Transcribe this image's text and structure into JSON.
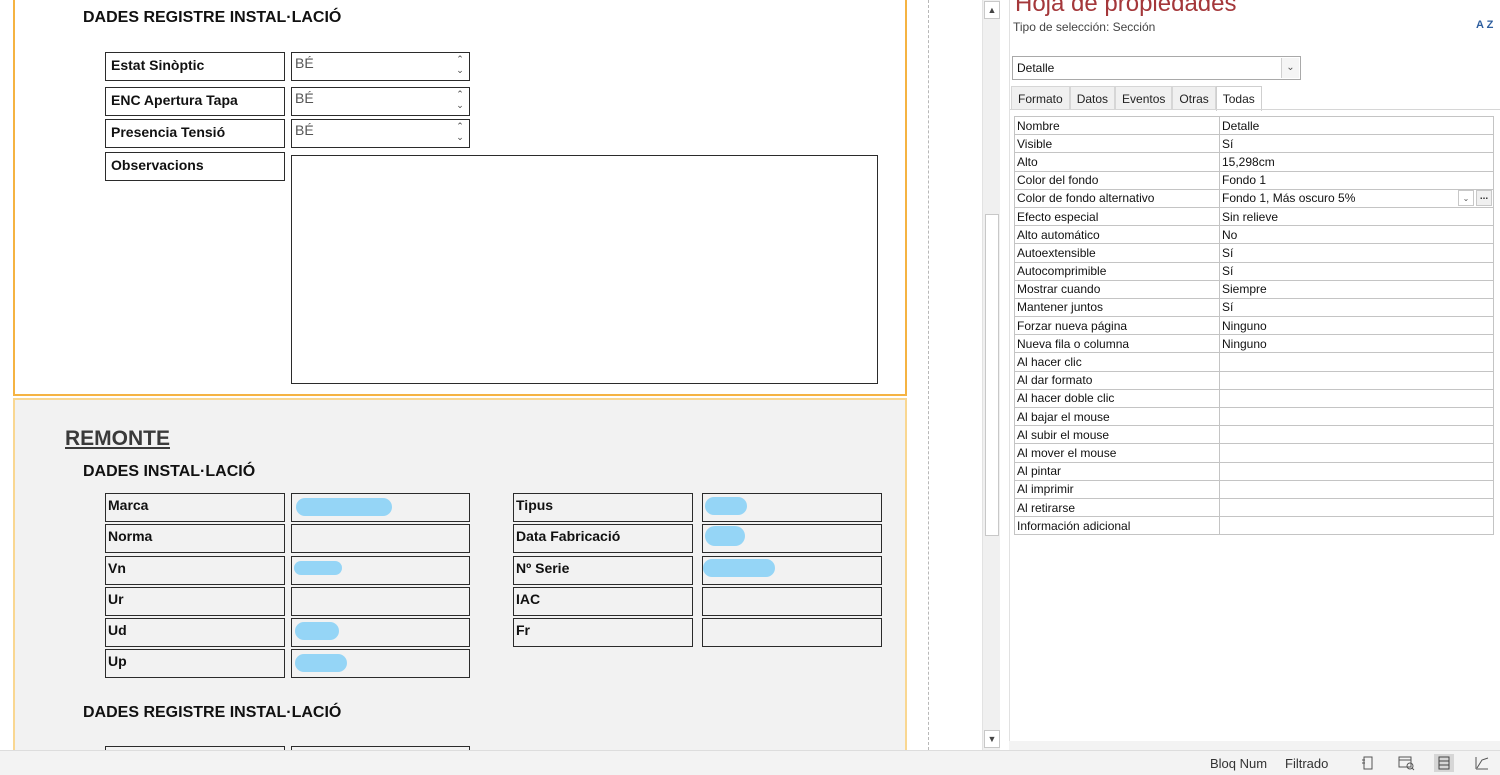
{
  "report": {
    "section_top": {
      "header": "DADES REGISTRE INSTAL·LACIÓ",
      "fields": [
        {
          "label": "Estat Sinòptic",
          "value": "BÉ"
        },
        {
          "label": "ENC Apertura Tapa",
          "value": "BÉ"
        },
        {
          "label": "Presencia Tensió",
          "value": "BÉ"
        }
      ],
      "observations_label": "Observacions"
    },
    "section_bottom": {
      "title": "REMONTE",
      "header": "DADES INSTAL·LACIÓ",
      "left_labels": [
        "Marca",
        "Norma",
        "Vn",
        "Ur",
        "Ud",
        "Up"
      ],
      "right_labels": [
        "Tipus",
        "Data Fabricació",
        "Nº Serie",
        "IAC",
        "Fr"
      ],
      "header2": "DADES REGISTRE INSTAL·LACIÓ"
    }
  },
  "property_sheet": {
    "title": "Hoja de propiedades",
    "selection_type": "Tipo de selección:  Sección",
    "sort_icon": "sort-az-icon",
    "sort_text": "A Z",
    "selected_object": "Detalle",
    "tabs": [
      "Formato",
      "Datos",
      "Eventos",
      "Otras",
      "Todas"
    ],
    "active_tab": "Todas",
    "rows": [
      {
        "name": "Nombre",
        "value": "Detalle"
      },
      {
        "name": "Visible",
        "value": "Sí"
      },
      {
        "name": "Alto",
        "value": "15,298cm"
      },
      {
        "name": "Color del fondo",
        "value": "Fondo 1"
      },
      {
        "name": "Color de fondo alternativo",
        "value": "Fondo 1, Más oscuro 5%"
      },
      {
        "name": "Efecto especial",
        "value": "Sin relieve"
      },
      {
        "name": "Alto automático",
        "value": "No"
      },
      {
        "name": "Autoextensible",
        "value": "Sí"
      },
      {
        "name": "Autocomprimible",
        "value": "Sí"
      },
      {
        "name": "Mostrar cuando",
        "value": "Siempre"
      },
      {
        "name": "Mantener juntos",
        "value": "Sí"
      },
      {
        "name": "Forzar nueva página",
        "value": "Ninguno"
      },
      {
        "name": "Nueva fila o columna",
        "value": "Ninguno"
      },
      {
        "name": "Al hacer clic",
        "value": ""
      },
      {
        "name": "Al dar formato",
        "value": ""
      },
      {
        "name": "Al hacer doble clic",
        "value": ""
      },
      {
        "name": "Al bajar el mouse",
        "value": ""
      },
      {
        "name": "Al subir el mouse",
        "value": ""
      },
      {
        "name": "Al mover el mouse",
        "value": ""
      },
      {
        "name": "Al pintar",
        "value": ""
      },
      {
        "name": "Al imprimir",
        "value": ""
      },
      {
        "name": "Al retirarse",
        "value": ""
      },
      {
        "name": "Información adicional",
        "value": ""
      }
    ]
  },
  "status_bar": {
    "numlock": "Bloq Num",
    "filter": "Filtrado",
    "icons": [
      "report-view-icon",
      "print-preview-icon",
      "layout-view-icon",
      "design-view-icon"
    ]
  },
  "colors": {
    "section_border": "#f5b342",
    "title_red": "#a4373a",
    "redaction": "#8fd3f6"
  }
}
